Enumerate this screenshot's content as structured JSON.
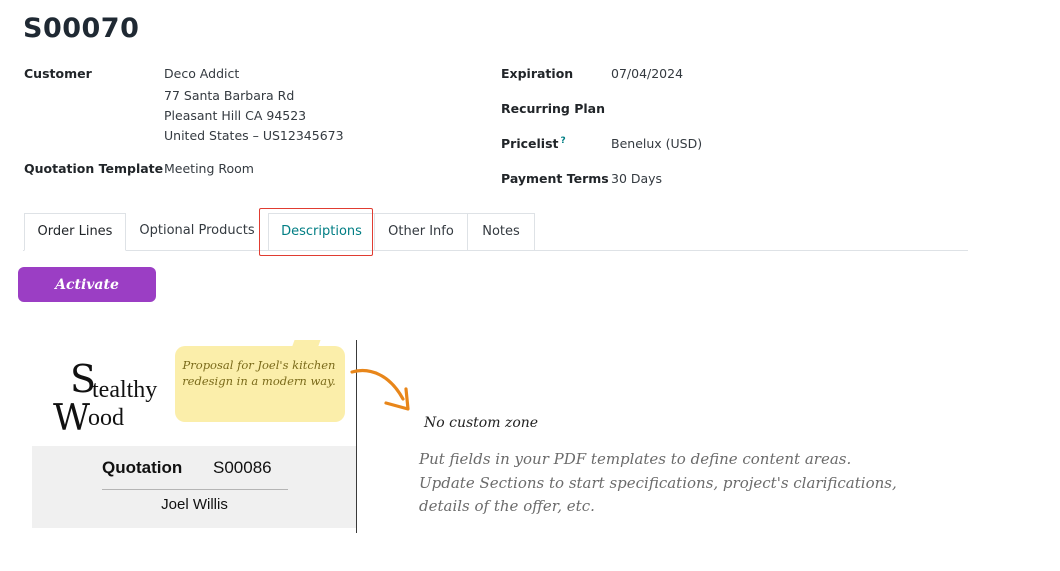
{
  "record": {
    "title": "S00070"
  },
  "left_fields": {
    "customer_label": "Customer",
    "customer_name": "Deco Addict",
    "address_line1": "77 Santa Barbara Rd",
    "address_line2": "Pleasant Hill CA 94523",
    "address_line3": "United States – US12345673",
    "template_label": "Quotation Template",
    "template_value": "Meeting Room"
  },
  "right_fields": {
    "expiration_label": "Expiration",
    "expiration_value": "07/04/2024",
    "recurring_label": "Recurring Plan",
    "recurring_value": "",
    "pricelist_label": "Pricelist",
    "pricelist_help": "?",
    "pricelist_value": "Benelux (USD)",
    "payment_label": "Payment Terms",
    "payment_value": "30 Days"
  },
  "tabs": [
    {
      "label": "Order Lines",
      "active": true
    },
    {
      "label": "Optional Products"
    },
    {
      "label": "Descriptions",
      "highlighted": true
    },
    {
      "label": "Other Info"
    },
    {
      "label": "Notes"
    }
  ],
  "activate_button": {
    "label": "Activate"
  },
  "preview": {
    "logo_line1": "tealthy",
    "logo_line2": "ood",
    "logo_s": "S",
    "logo_w": "W",
    "quote_title": "Quotation",
    "quote_number": "S00086",
    "customer_name": "Joel Willis",
    "note_text": "Proposal for Joel's kitchen redesign in a modern way."
  },
  "empty_state": {
    "title": "No custom zone",
    "body_line1": "Put fields in your PDF templates to define content areas.",
    "body_line2": "Update Sections to start specifications, project's clarifications,",
    "body_line3": "details of the offer, etc."
  },
  "colors": {
    "accent_purple": "#9b3ec4",
    "tab_teal": "#017e84",
    "highlight_red": "#e03c31",
    "note_yellow": "#fbeeaa",
    "arrow_orange": "#e8861a"
  }
}
